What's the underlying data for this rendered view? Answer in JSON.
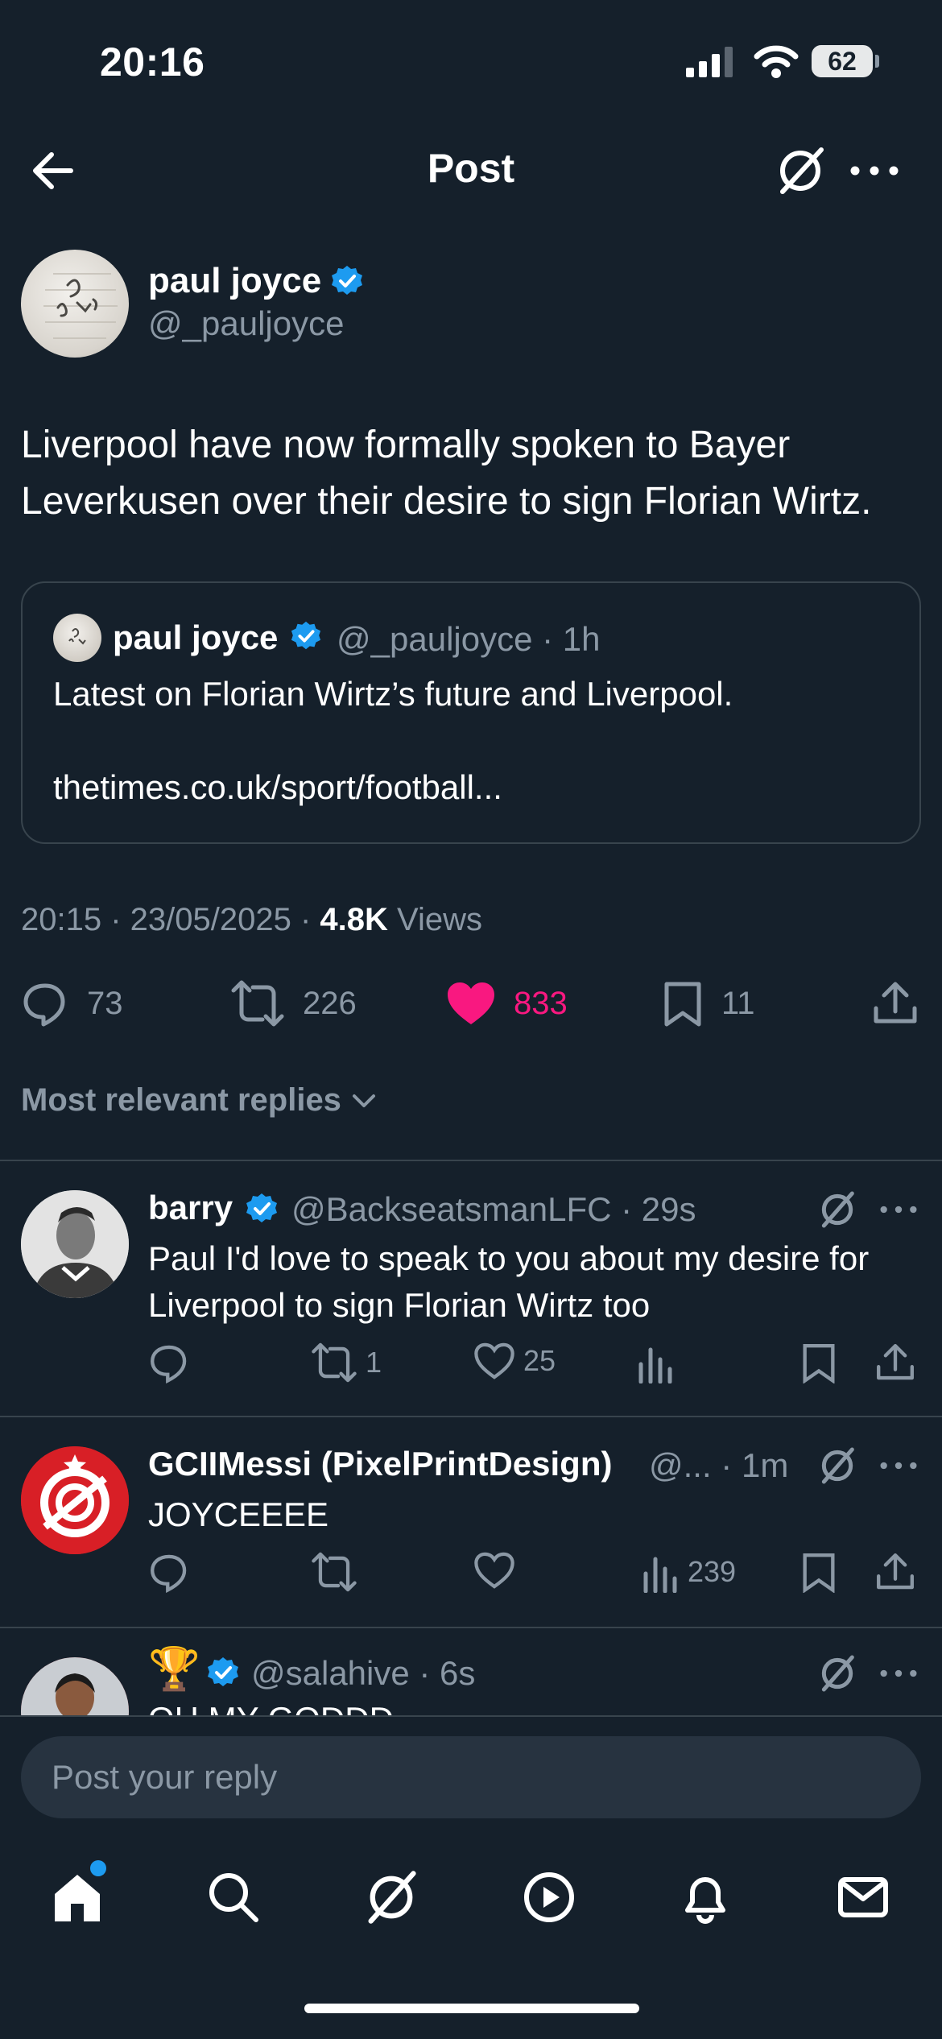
{
  "status": {
    "time": "20:16",
    "battery": "62",
    "battery_level": 0.62
  },
  "header": {
    "title": "Post"
  },
  "post": {
    "author_name": "paul joyce",
    "author_handle": "@_pauljoyce",
    "text": "Liverpool have now formally spoken to Bayer Leverkusen over their desire to sign Florian Wirtz.",
    "quote": {
      "author_name": "paul joyce",
      "handle_time": "@_pauljoyce · 1h",
      "text": "Latest on Florian Wirtz’s future and Liverpool.",
      "link": "thetimes.co.uk/sport/football..."
    },
    "time_date": "20:15 · 23/05/2025 · ",
    "views_count": "4.8K",
    "views_label": " Views",
    "stats": {
      "replies": "73",
      "reposts": "226",
      "likes": "833",
      "bookmarks": "11"
    }
  },
  "sort": {
    "label": "Most relevant replies"
  },
  "replies": [
    {
      "name": "barry",
      "handle_time": "@BackseatsmanLFC · 29s",
      "text": "Paul I'd love to speak to you about my desire for Liverpool to sign Florian Wirtz too",
      "reply_count": "",
      "repost_count": "1",
      "like_count": "25",
      "view_count": ""
    },
    {
      "name": "GCIIMessi (PixelPrintDesign)",
      "handle_time": "@... · 1m",
      "text": "JOYCEEEE",
      "reply_count": "",
      "repost_count": "",
      "like_count": "",
      "view_count": "239"
    },
    {
      "name": "🏆",
      "handle_time": "@salahive · 6s",
      "text": "OH MY GODDD"
    }
  ],
  "composer": {
    "placeholder": "Post your reply"
  },
  "tabs": [
    "home-icon",
    "search-icon",
    "grok-icon",
    "video-icon",
    "notifications-icon",
    "messages-icon"
  ],
  "colors": {
    "background": "#15202b",
    "accent": "#1d9bf0",
    "like": "#f91880",
    "muted": "#8b98a5"
  }
}
